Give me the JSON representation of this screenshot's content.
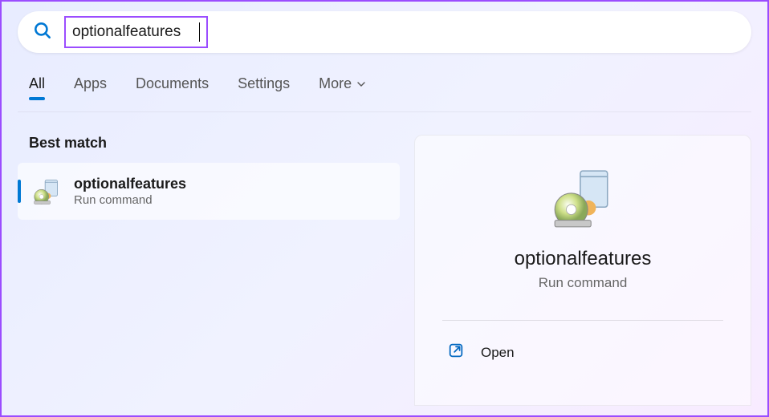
{
  "search": {
    "query": "optionalfeatures"
  },
  "tabs": {
    "all": "All",
    "apps": "Apps",
    "documents": "Documents",
    "settings": "Settings",
    "more": "More"
  },
  "sections": {
    "best_match": "Best match"
  },
  "result": {
    "title": "optionalfeatures",
    "subtitle": "Run command"
  },
  "detail": {
    "title": "optionalfeatures",
    "subtitle": "Run command",
    "actions": {
      "open": "Open"
    }
  }
}
